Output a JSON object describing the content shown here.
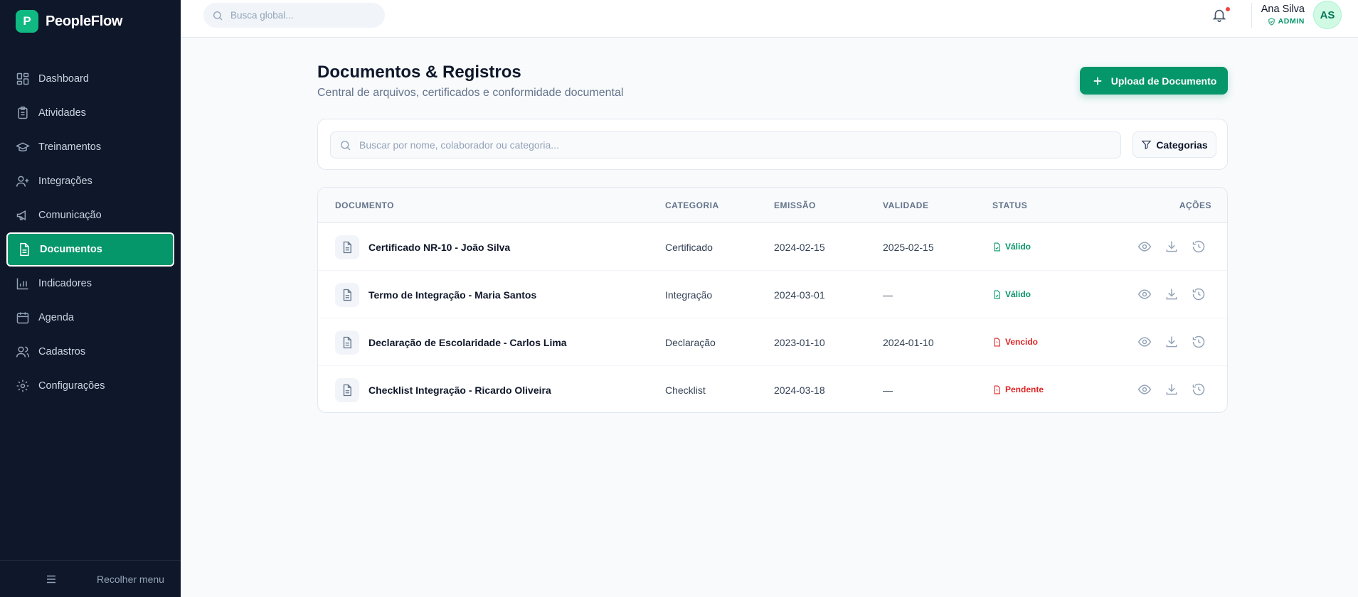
{
  "brand": {
    "logo_letter": "P",
    "name": "PeopleFlow",
    "accent": "#10b981"
  },
  "sidebar": {
    "items": [
      {
        "label": "Dashboard",
        "icon": "dashboard-icon",
        "active": false
      },
      {
        "label": "Atividades",
        "icon": "clipboard-icon",
        "active": false
      },
      {
        "label": "Treinamentos",
        "icon": "graduation-cap-icon",
        "active": false
      },
      {
        "label": "Integrações",
        "icon": "user-plus-icon",
        "active": false
      },
      {
        "label": "Comunicação",
        "icon": "megaphone-icon",
        "active": false
      },
      {
        "label": "Documentos",
        "icon": "file-text-icon",
        "active": true
      },
      {
        "label": "Indicadores",
        "icon": "bar-chart-icon",
        "active": false
      },
      {
        "label": "Agenda",
        "icon": "calendar-icon",
        "active": false
      },
      {
        "label": "Cadastros",
        "icon": "users-icon",
        "active": false
      },
      {
        "label": "Configurações",
        "icon": "gear-icon",
        "active": false
      }
    ],
    "collapse_label": "Recolher menu"
  },
  "topbar": {
    "search_placeholder": "Busca global...",
    "user_name": "Ana Silva",
    "user_role": "ADMIN",
    "avatar_initials": "AS",
    "has_notification": true
  },
  "page": {
    "title": "Documentos & Registros",
    "subtitle": "Central de arquivos, certificados e conformidade documental",
    "upload_label": "Upload de Documento",
    "search_placeholder": "Buscar por nome, colaborador ou categoria...",
    "categories_label": "Categorias"
  },
  "table": {
    "headers": {
      "documento": "DOCUMENTO",
      "categoria": "CATEGORIA",
      "emissao": "EMISSÃO",
      "validade": "VALIDADE",
      "status": "STATUS",
      "acoes": "AÇÕES"
    },
    "rows": [
      {
        "name": "Certificado NR-10 - João Silva",
        "category": "Certificado",
        "issued": "2024-02-15",
        "valid": "2025-02-15",
        "status": "Válido",
        "status_type": "ok"
      },
      {
        "name": "Termo de Integração - Maria Santos",
        "category": "Integração",
        "issued": "2024-03-01",
        "valid": "—",
        "status": "Válido",
        "status_type": "ok"
      },
      {
        "name": "Declaração de Escolaridade - Carlos Lima",
        "category": "Declaração",
        "issued": "2023-01-10",
        "valid": "2024-01-10",
        "status": "Vencido",
        "status_type": "bad"
      },
      {
        "name": "Checklist Integração - Ricardo Oliveira",
        "category": "Checklist",
        "issued": "2024-03-18",
        "valid": "—",
        "status": "Pendente",
        "status_type": "bad"
      }
    ]
  },
  "colors": {
    "primary": "#059669",
    "sidebar_bg": "#0f172a",
    "ok": "#059669",
    "bad": "#dc2626"
  }
}
